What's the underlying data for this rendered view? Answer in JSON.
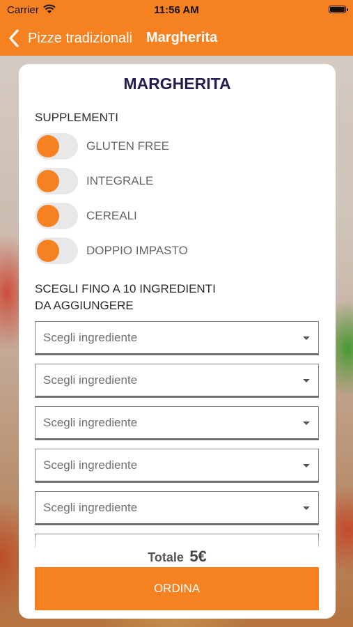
{
  "status_bar": {
    "carrier": "Carrier",
    "time": "11:56 AM"
  },
  "nav": {
    "back_label": "Pizze tradizionali",
    "title": "Margherita"
  },
  "card": {
    "title": "MARGHERITA",
    "supplements_label": "SUPPLEMENTI",
    "supplements": [
      {
        "label": "GLUTEN FREE",
        "on": false
      },
      {
        "label": "INTEGRALE",
        "on": false
      },
      {
        "label": "CEREALI",
        "on": false
      },
      {
        "label": "DOPPIO IMPASTO",
        "on": false
      }
    ],
    "ingredients_label_line1": "SCEGLI FINO A 10 INGREDIENTI",
    "ingredients_label_line2": "DA AGGIUNGERE",
    "ingredient_selects": [
      {
        "placeholder": "Scegli ingrediente"
      },
      {
        "placeholder": "Scegli ingrediente"
      },
      {
        "placeholder": "Scegli ingrediente"
      },
      {
        "placeholder": "Scegli ingrediente"
      },
      {
        "placeholder": "Scegli ingrediente"
      }
    ],
    "total_label": "Totale",
    "total_amount": "5€",
    "order_button": "ORDINA"
  },
  "colors": {
    "accent": "#f68120",
    "title": "#231c4f"
  },
  "icons": [
    "wifi-icon",
    "battery-icon",
    "chevron-left-icon",
    "dropdown-caret-icon"
  ]
}
